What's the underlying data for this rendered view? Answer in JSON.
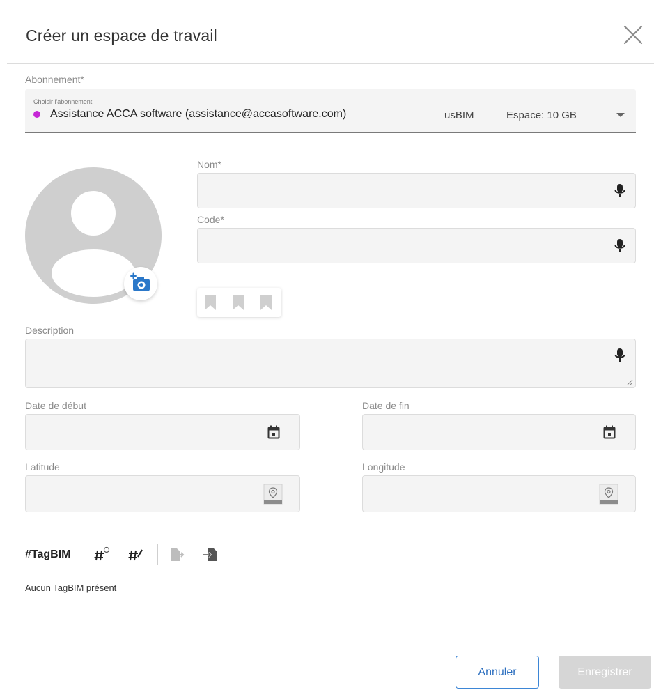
{
  "dialog": {
    "title": "Créer un espace de travail"
  },
  "subscription": {
    "label": "Abonnement*",
    "small_label": "Choisir l'abonnement",
    "name": "Assistance ACCA software (assistance@accasoftware.com)",
    "plan": "usBIM",
    "space": "Espace: 10 GB",
    "dot_color": "#c627d6"
  },
  "fields": {
    "nom_label": "Nom*",
    "code_label": "Code*",
    "description_label": "Description",
    "start_date_label": "Date de début",
    "end_date_label": "Date de fin",
    "latitude_label": "Latitude",
    "longitude_label": "Longitude",
    "nom_value": "",
    "code_value": "",
    "description_value": ""
  },
  "tags": {
    "label": "#TagBIM",
    "empty_text": "Aucun TagBIM présent",
    "icons": [
      "tag-add-icon",
      "tag-edit-icon",
      "export-icon",
      "import-icon"
    ]
  },
  "buttons": {
    "cancel": "Annuler",
    "save": "Enregistrer"
  },
  "colors": {
    "accent": "#3d86d6",
    "disabled": "#d6d6d6"
  }
}
